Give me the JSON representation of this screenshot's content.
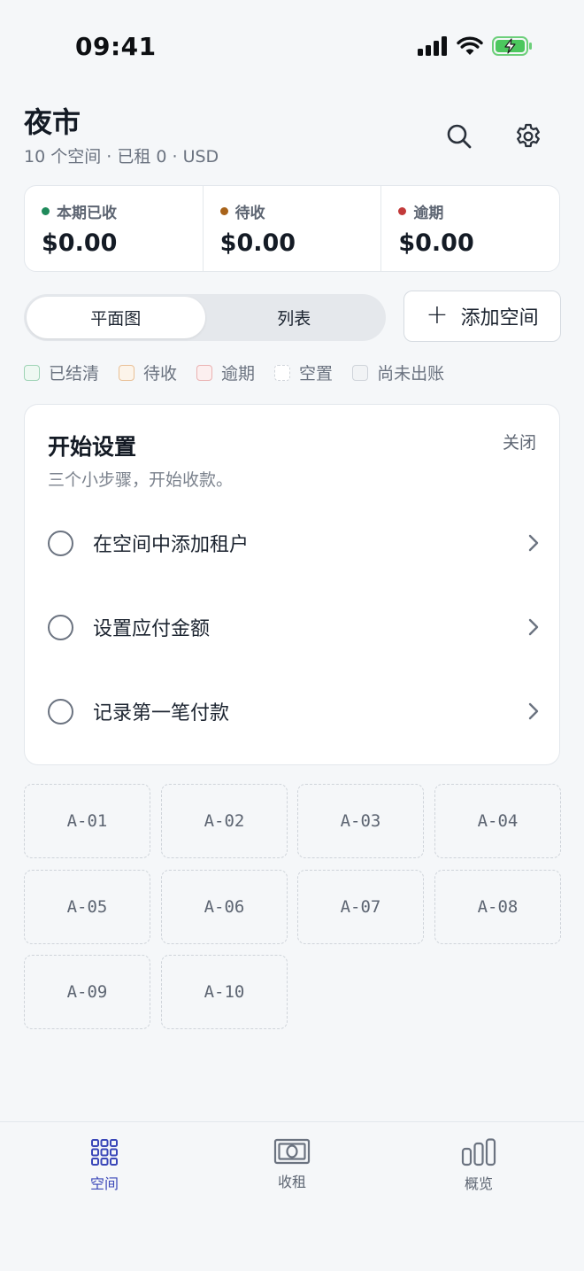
{
  "status_bar": {
    "time": "09:41"
  },
  "header": {
    "title": "夜市",
    "subtitle": "10 个空间 · 已租 0 · USD"
  },
  "stats": [
    {
      "label": "本期已收",
      "value": "$0.00",
      "color": "#1f8a5b"
    },
    {
      "label": "待收",
      "value": "$0.00",
      "color": "#a8631a"
    },
    {
      "label": "逾期",
      "value": "$0.00",
      "color": "#c23a3a"
    }
  ],
  "view_toggle": {
    "options": [
      "平面图",
      "列表"
    ],
    "selected": "平面图"
  },
  "add_space_button": {
    "label": "添加空间"
  },
  "legend": [
    {
      "label": "已结清",
      "border": "#9ed3b5",
      "fill": "#eef8f2",
      "style": "solid"
    },
    {
      "label": "待收",
      "border": "#e9c096",
      "fill": "#fcf4ea",
      "style": "solid"
    },
    {
      "label": "逾期",
      "border": "#eab2b2",
      "fill": "#fcefef",
      "style": "solid"
    },
    {
      "label": "空置",
      "border": "#cfd4da",
      "fill": "#ffffff",
      "style": "dashed"
    },
    {
      "label": "尚未出账",
      "border": "#cfd4da",
      "fill": "#f1f3f5",
      "style": "solid"
    }
  ],
  "setup_card": {
    "title": "开始设置",
    "close_label": "关闭",
    "subtitle": "三个小步骤，开始收款。",
    "steps": [
      {
        "label": "在空间中添加租户"
      },
      {
        "label": "设置应付金额"
      },
      {
        "label": "记录第一笔付款"
      }
    ]
  },
  "spaces": [
    "A-01",
    "A-02",
    "A-03",
    "A-04",
    "A-05",
    "A-06",
    "A-07",
    "A-08",
    "A-09",
    "A-10"
  ],
  "tab_bar": {
    "tabs": [
      {
        "label": "空间",
        "icon": "grid-icon",
        "active": true
      },
      {
        "label": "收租",
        "icon": "cash-icon",
        "active": false
      },
      {
        "label": "概览",
        "icon": "bar-chart-icon",
        "active": false
      }
    ],
    "accent": "#3a47b8"
  }
}
